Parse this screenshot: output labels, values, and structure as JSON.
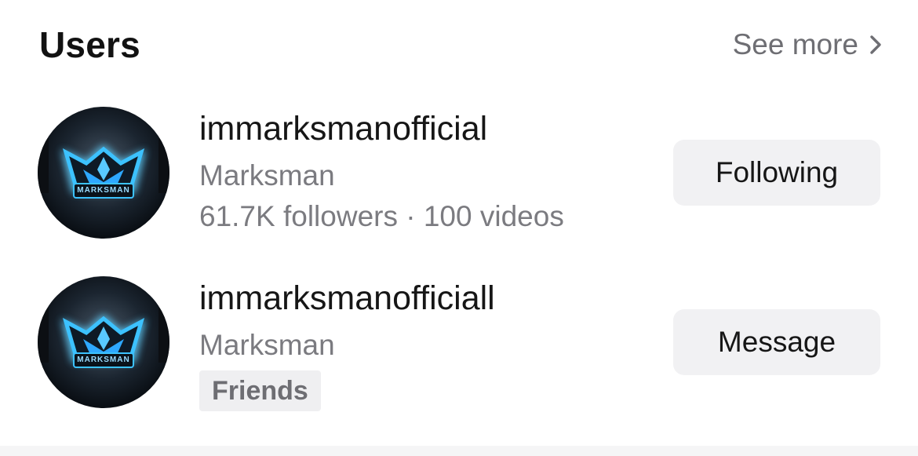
{
  "section": {
    "title": "Users",
    "see_more_label": "See more",
    "see_more_icon": "chevron-right-icon"
  },
  "users": [
    {
      "username": "immarksmanofficial",
      "display_name": "Marksman",
      "stats": "61.7K followers · 100 videos",
      "action_label": "Following",
      "avatar_logo_text": "MARKSMAN"
    },
    {
      "username": "immarksmanofficiall",
      "display_name": "Marksman",
      "badge": "Friends",
      "action_label": "Message",
      "avatar_logo_text": "MARKSMAN"
    }
  ],
  "colors": {
    "title": "#121212",
    "secondary_text": "#7b7b80",
    "button_bg": "#f1f1f3",
    "avatar_glow": "#29a8ff"
  }
}
